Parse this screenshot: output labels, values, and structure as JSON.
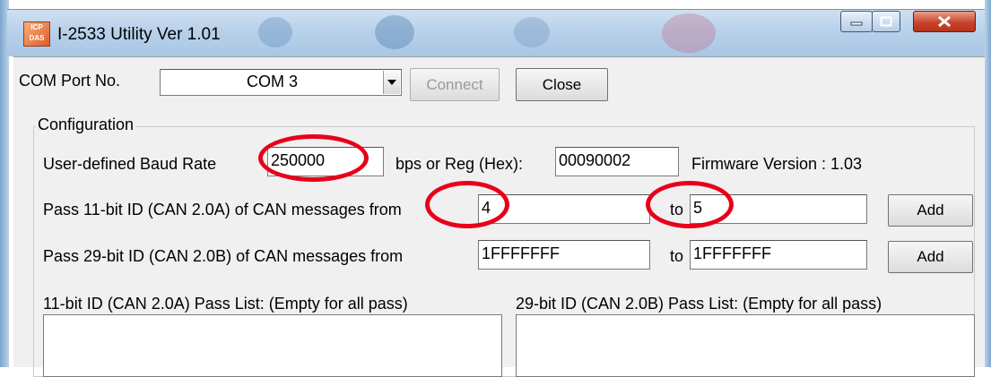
{
  "window": {
    "title": "I-2533 Utility Ver 1.01",
    "icon_label": "ICP DAS"
  },
  "com_port": {
    "label": "COM Port No.",
    "selected": "COM 3",
    "connect_label": "Connect",
    "close_label": "Close"
  },
  "configuration": {
    "caption": "Configuration",
    "baud_label": "User-defined Baud Rate",
    "baud_value": "250000",
    "reg_label": "bps or Reg (Hex):",
    "reg_value": "00090002",
    "firmware_text": "Firmware Version : 1.03",
    "pass11_label": "Pass 11-bit ID (CAN 2.0A) of CAN messages from",
    "pass11_from": "4",
    "pass11_to_label": "to",
    "pass11_to": "5",
    "pass11_add": "Add",
    "pass29_label": "Pass 29-bit ID (CAN 2.0B) of CAN messages from",
    "pass29_from": "1FFFFFFF",
    "pass29_to_label": "to",
    "pass29_to": "1FFFFFFF",
    "pass29_add": "Add",
    "list11_label": "11-bit ID (CAN 2.0A) Pass List: (Empty for all pass)",
    "list29_label": "29-bit ID (CAN 2.0B) Pass List: (Empty for all pass)"
  },
  "annotations": {
    "color": "#e8001b"
  }
}
